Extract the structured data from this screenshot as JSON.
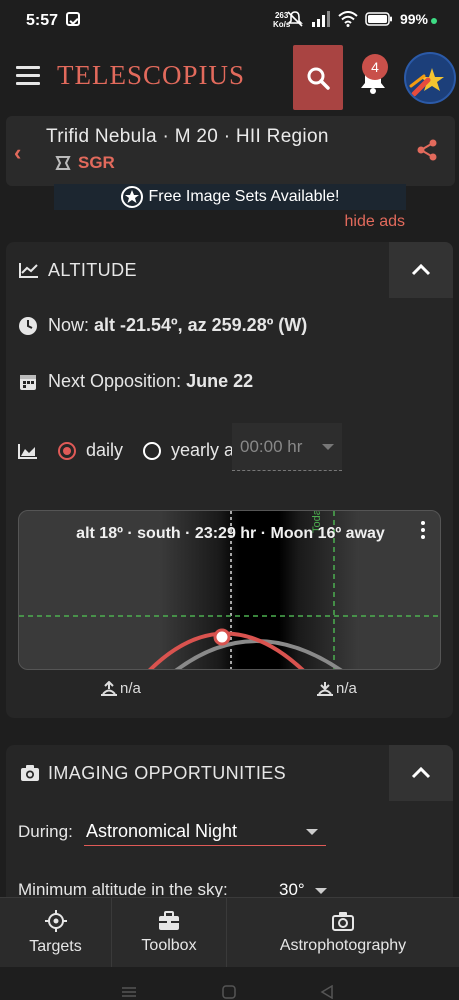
{
  "status_bar": {
    "time": "5:57",
    "speed_value": "263",
    "speed_unit": "Ko/s",
    "battery": "99%"
  },
  "header": {
    "brand": "TELESCOPIUS",
    "notification_count": "4"
  },
  "object": {
    "title": "Trifid Nebula · M 20 · HII Region",
    "constellation": "SGR"
  },
  "ad": {
    "text": "Free Image Sets Available!",
    "hide_label": "hide ads"
  },
  "altitude": {
    "title": "ALTITUDE",
    "now_label": "Now:",
    "now_value": "alt -21.54º, az 259.28º (W)",
    "opposition_label": "Next Opposition:",
    "opposition_value": "June 22",
    "mode_daily": "daily",
    "mode_yearly": "yearly at",
    "time_placeholder": "00:00 hr",
    "chart_caption": "alt 18º · south · 23:29 hr · Moon 16º away",
    "today_label": "Today",
    "rise_label": "n/a",
    "set_label": "n/a"
  },
  "imaging": {
    "title": "IMAGING OPPORTUNITIES",
    "during_label": "During:",
    "during_value": "Astronomical Night",
    "min_alt_label": "Minimum altitude in the sky:",
    "min_alt_value": "30°"
  },
  "tabs": [
    {
      "label": "Targets",
      "icon": "crosshair-icon"
    },
    {
      "label": "Toolbox",
      "icon": "toolbox-icon"
    },
    {
      "label": "Astrophotography",
      "icon": "camera-icon"
    }
  ],
  "colors": {
    "accent": "#e26a5c",
    "search_bg": "#a94442",
    "guide_green": "#4caf50"
  }
}
